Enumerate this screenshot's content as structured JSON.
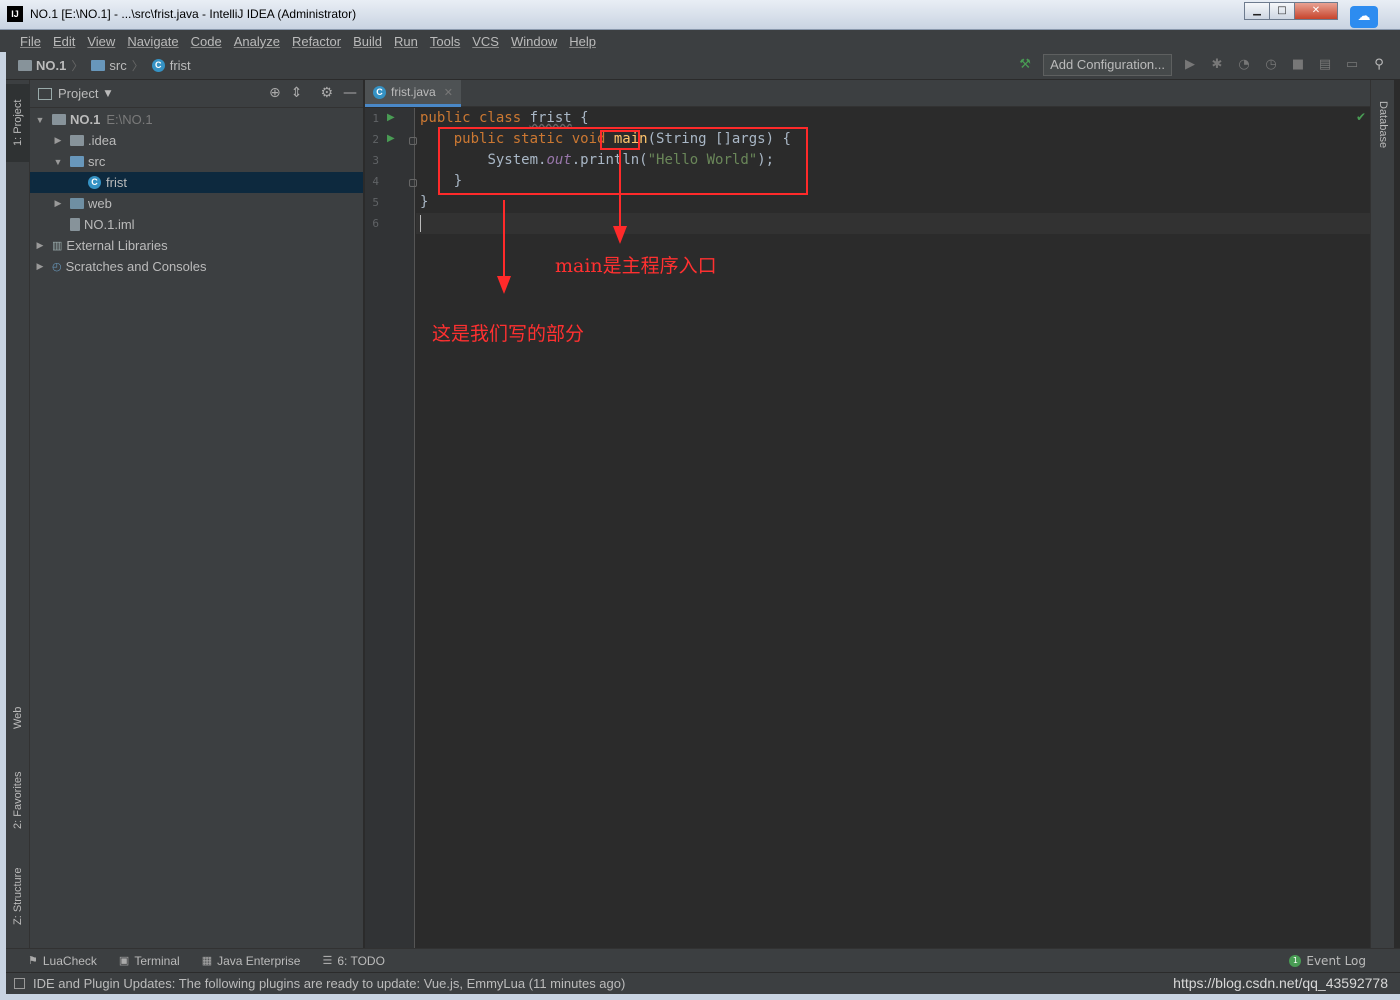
{
  "window": {
    "title": "NO.1 [E:\\NO.1] - ...\\src\\frist.java - IntelliJ IDEA (Administrator)",
    "app_icon_text": "IJ",
    "minimize": "▁",
    "maximize": "□",
    "close": "✕"
  },
  "menu": [
    "File",
    "Edit",
    "View",
    "Navigate",
    "Code",
    "Analyze",
    "Refactor",
    "Build",
    "Run",
    "Tools",
    "VCS",
    "Window",
    "Help"
  ],
  "breadcrumbs": [
    "NO.1",
    "src",
    "frist"
  ],
  "toolbar": {
    "add_config_label": "Add Configuration..."
  },
  "left_stripe": {
    "project": "1: Project",
    "web": "Web",
    "favorites": "2: Favorites",
    "structure": "Z: Structure"
  },
  "right_stripe": {
    "database": "Database"
  },
  "project_panel": {
    "title": "Project",
    "tree": [
      {
        "label": "NO.1",
        "extra": "E:\\NO.1"
      },
      {
        "label": ".idea"
      },
      {
        "label": "src"
      },
      {
        "label": "frist"
      },
      {
        "label": "web"
      },
      {
        "label": "NO.1.iml"
      },
      {
        "label": "External Libraries"
      },
      {
        "label": "Scratches and Consoles"
      }
    ]
  },
  "editor": {
    "tab_label": "frist.java",
    "line_numbers": [
      "1",
      "2",
      "3",
      "4",
      "5",
      "6"
    ],
    "code": {
      "l1_kw": "public class ",
      "l1_cls": "frist",
      "l1_rest": " {",
      "l2_indent": "    ",
      "l2_kw": "public static void ",
      "l2_fn": "main",
      "l2_rest": "(String []args) {",
      "l3_indent": "        ",
      "l3_a": "System.",
      "l3_fld": "out",
      "l3_b": ".println(",
      "l3_str": "\"Hello World\"",
      "l3_c": ");",
      "l4": "    }",
      "l5": "}"
    }
  },
  "annotations": {
    "main_label": "main是主程序入口",
    "our_part_label": "这是我们写的部分"
  },
  "bottom_tools": [
    "LuaCheck",
    "Terminal",
    "Java Enterprise",
    "6: TODO"
  ],
  "event_log": "Event Log",
  "status": {
    "message": "IDE and Plugin Updates: The following plugins are ready to update: Vue.js, EmmyLua (11 minutes ago)",
    "watermark": "https://blog.csdn.net/qq_43592778"
  },
  "colors": {
    "keyword": "#cc7832",
    "method": "#ffc66d",
    "string": "#6a8759",
    "field": "#9876aa",
    "annotation": "#ff2a2a"
  }
}
